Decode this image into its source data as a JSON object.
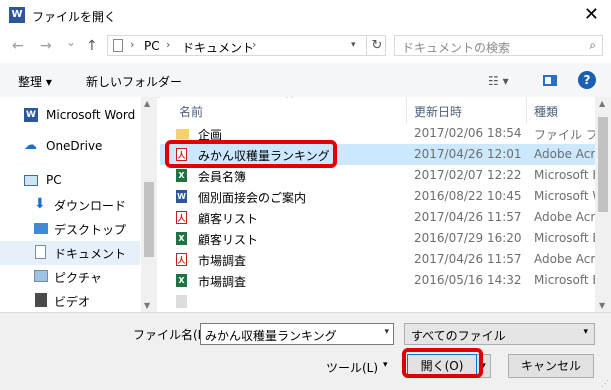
{
  "window": {
    "title": "ファイルを開く",
    "app_icon": "W",
    "close": "✕"
  },
  "nav": {
    "back": "←",
    "forward": "→",
    "recent": "⌄",
    "up": "↑",
    "breadcrumb": [
      "PC",
      "ドキュメント"
    ],
    "crumb_sep": "›",
    "refresh": "↻",
    "search_placeholder": "ドキュメントの検索",
    "search_icon": "⌕"
  },
  "toolbar": {
    "organize": "整理 ▾",
    "new_folder": "新しいフォルダー",
    "view": "☷ ▾",
    "help": "?"
  },
  "sidebar": {
    "items": [
      {
        "label": "Microsoft Word",
        "icon": "W"
      },
      {
        "label": "OneDrive",
        "icon": "☁"
      },
      {
        "label": "PC",
        "icon": ""
      },
      {
        "label": "ダウンロード",
        "icon": "⬇"
      },
      {
        "label": "デスクトップ",
        "icon": ""
      },
      {
        "label": "ドキュメント",
        "icon": ""
      },
      {
        "label": "ピクチャ",
        "icon": ""
      },
      {
        "label": "ビデオ",
        "icon": ""
      }
    ]
  },
  "list": {
    "columns": {
      "name": "名前",
      "date": "更新日時",
      "type": "種類"
    },
    "rows": [
      {
        "name": "企画",
        "date": "2017/02/06 18:54",
        "type": "ファイル フォルダー",
        "kind": "folder"
      },
      {
        "name": "みかん収穫量ランキング",
        "date": "2017/04/26 12:01",
        "type": "Adobe Acrobat",
        "kind": "pdf"
      },
      {
        "name": "会員名簿",
        "date": "2017/02/07 12:22",
        "type": "Microsoft Excel",
        "kind": "xls"
      },
      {
        "name": "個別面接会のご案内",
        "date": "2016/08/22 10:45",
        "type": "Microsoft Word",
        "kind": "doc"
      },
      {
        "name": "顧客リスト",
        "date": "2017/04/26 11:57",
        "type": "Adobe Acrobat",
        "kind": "pdf"
      },
      {
        "name": "顧客リスト",
        "date": "2016/07/29 16:20",
        "type": "Microsoft Excel",
        "kind": "xls"
      },
      {
        "name": "市場調査",
        "date": "2017/04/26 11:57",
        "type": "Adobe Acrobat",
        "kind": "pdf"
      },
      {
        "name": "市場調査",
        "date": "2016/05/16 14:32",
        "type": "Microsoft Excel",
        "kind": "xls"
      }
    ]
  },
  "bottom": {
    "filename_label": "ファイル名(N):",
    "filename_value": "みかん収穫量ランキング",
    "filetype": "すべてのファイル",
    "tools": "ツール(L)",
    "open": "開く(O)",
    "cancel": "キャンセル"
  }
}
